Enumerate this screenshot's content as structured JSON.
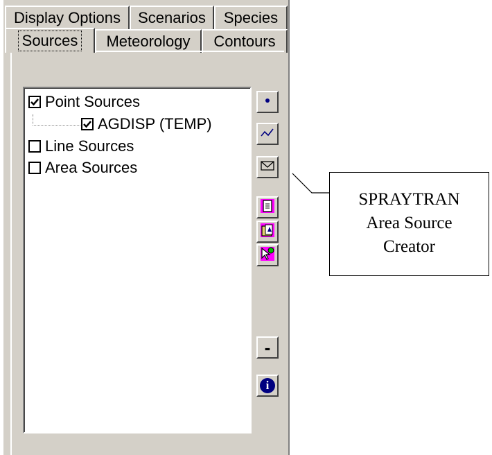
{
  "tabs_row1": [
    {
      "label": "Display Options"
    },
    {
      "label": "Scenarios"
    },
    {
      "label": "Species"
    }
  ],
  "tabs_row2": [
    {
      "label": "Sources",
      "active": true
    },
    {
      "label": "Meteorology"
    },
    {
      "label": "Contours"
    }
  ],
  "tree": {
    "items": [
      {
        "label": "Point Sources",
        "checked": true
      },
      {
        "label": "AGDISP (TEMP)",
        "checked": true
      },
      {
        "label": "Line Sources",
        "checked": false
      },
      {
        "label": "Area Sources",
        "checked": false
      }
    ]
  },
  "toolbar": [
    {
      "icon": "point-source-icon"
    },
    {
      "icon": "line-source-icon"
    },
    {
      "icon": "area-source-icon"
    },
    {
      "icon": "document-icon"
    },
    {
      "icon": "open-file-icon"
    },
    {
      "icon": "select-pointer-icon"
    },
    {
      "icon": "remove-icon",
      "label": "-"
    },
    {
      "icon": "info-icon",
      "label": "i"
    }
  ],
  "callout": {
    "line1": "SPRAYTRAN",
    "line2": "Area Source",
    "line3": "Creator"
  },
  "colors": {
    "panel": "#d4d0c8",
    "icon_blue": "#000080",
    "icon_magenta": "#ff00ff"
  }
}
